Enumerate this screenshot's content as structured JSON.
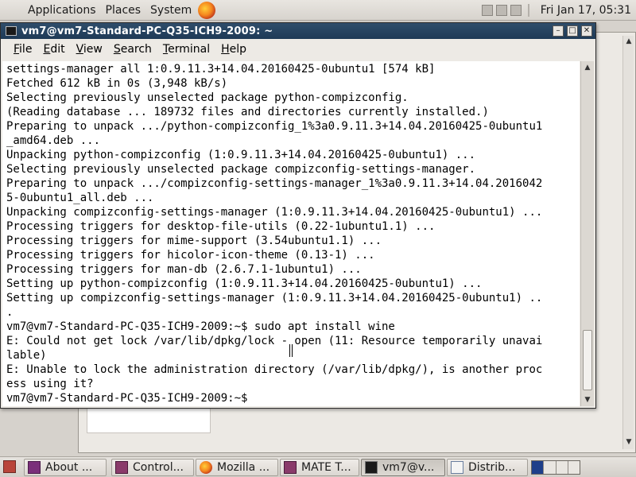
{
  "top_panel": {
    "menus": [
      "Applications",
      "Places",
      "System"
    ],
    "clock": "Fri Jan 17, 05:31"
  },
  "terminal": {
    "title": "vm7@vm7-Standard-PC-Q35-ICH9-2009: ~",
    "window_buttons": [
      "minimize",
      "maximize",
      "close"
    ],
    "menu": {
      "file": {
        "u": "F",
        "rest": "ile"
      },
      "edit": {
        "u": "E",
        "rest": "dit"
      },
      "view": {
        "u": "V",
        "rest": "iew"
      },
      "search": {
        "u": "S",
        "rest": "earch"
      },
      "terminal": {
        "u": "T",
        "rest": "erminal"
      },
      "help": {
        "u": "H",
        "rest": "elp"
      }
    },
    "lines": [
      "settings-manager all 1:0.9.11.3+14.04.20160425-0ubuntu1 [574 kB]",
      "Fetched 612 kB in 0s (3,948 kB/s)",
      "Selecting previously unselected package python-compizconfig.",
      "(Reading database ... 189732 files and directories currently installed.)",
      "Preparing to unpack .../python-compizconfig_1%3a0.9.11.3+14.04.20160425-0ubuntu1",
      "_amd64.deb ...",
      "Unpacking python-compizconfig (1:0.9.11.3+14.04.20160425-0ubuntu1) ...",
      "Selecting previously unselected package compizconfig-settings-manager.",
      "Preparing to unpack .../compizconfig-settings-manager_1%3a0.9.11.3+14.04.2016042",
      "5-0ubuntu1_all.deb ...",
      "Unpacking compizconfig-settings-manager (1:0.9.11.3+14.04.20160425-0ubuntu1) ...",
      "Processing triggers for desktop-file-utils (0.22-1ubuntu1.1) ...",
      "Processing triggers for mime-support (3.54ubuntu1.1) ...",
      "Processing triggers for hicolor-icon-theme (0.13-1) ...",
      "Processing triggers for man-db (2.6.7.1-1ubuntu1) ...",
      "Setting up python-compizconfig (1:0.9.11.3+14.04.20160425-0ubuntu1) ...",
      "Setting up compizconfig-settings-manager (1:0.9.11.3+14.04.20160425-0ubuntu1) ..",
      ".",
      "vm7@vm7-Standard-PC-Q35-ICH9-2009:~$ sudo apt install wine",
      "E: Could not get lock /var/lib/dpkg/lock - open (11: Resource temporarily unavai",
      "lable)",
      "E: Unable to lock the administration directory (/var/lib/dpkg/), is another proc",
      "ess using it?",
      "vm7@vm7-Standard-PC-Q35-ICH9-2009:~$ "
    ]
  },
  "taskbar": {
    "tasks": [
      {
        "label": "About ...",
        "icon": "about-icon"
      },
      {
        "label": "Control...",
        "icon": "control-center-icon"
      },
      {
        "label": "Mozilla ...",
        "icon": "firefox-icon"
      },
      {
        "label": "MATE T...",
        "icon": "mate-terminal-icon"
      },
      {
        "label": "vm7@v...",
        "icon": "terminal-icon"
      },
      {
        "label": "Distrib...",
        "icon": "window-icon"
      }
    ],
    "active_task": 4,
    "workspaces": 4,
    "active_workspace": 0
  }
}
